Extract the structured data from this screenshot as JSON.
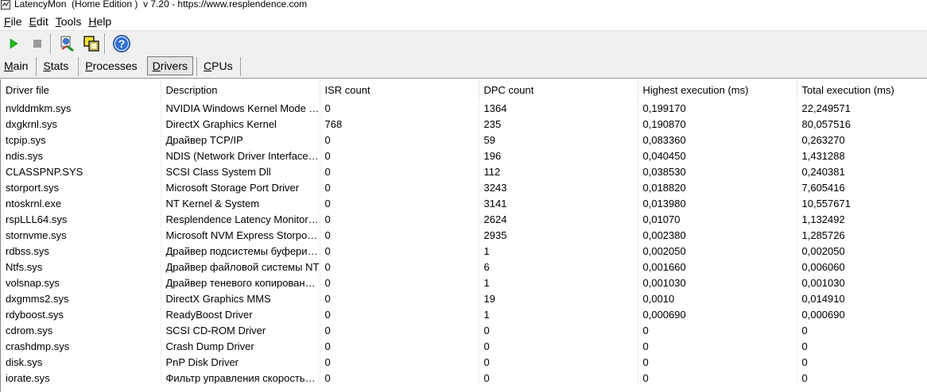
{
  "window": {
    "title": "LatencyMon  (Home Edition )  v 7.20 - https://www.resplendence.com"
  },
  "menu": [
    {
      "acc": "F",
      "rest": "ile"
    },
    {
      "acc": "E",
      "rest": "dit"
    },
    {
      "acc": "T",
      "rest": "ools"
    },
    {
      "acc": "H",
      "rest": "elp"
    }
  ],
  "toolbar": {
    "start_icon": "play-icon",
    "stop_icon": "stop-icon",
    "properties_icon": "driver-properties-icon",
    "report_icon": "copy-report-icon",
    "help_icon": "help-icon"
  },
  "tabs": [
    {
      "acc": "M",
      "rest": "ain"
    },
    {
      "acc": "S",
      "rest": "tats"
    },
    {
      "acc": "P",
      "rest": "rocesses"
    },
    {
      "acc": "D",
      "rest": "rivers"
    },
    {
      "acc": "C",
      "rest": "PUs"
    }
  ],
  "table": {
    "columns": [
      "Driver file",
      "Description",
      "ISR count",
      "DPC count",
      "Highest execution (ms)",
      "Total execution (ms)"
    ],
    "rows": [
      [
        "nvlddmkm.sys",
        "NVIDIA Windows Kernel Mode Driver",
        "0",
        "1364",
        "0,199170",
        "22,249571"
      ],
      [
        "dxgkrnl.sys",
        "DirectX Graphics Kernel",
        "768",
        "235",
        "0,190870",
        "80,057516"
      ],
      [
        "tcpip.sys",
        "Драйвер TCP/IP",
        "0",
        "59",
        "0,083360",
        "0,263270"
      ],
      [
        "ndis.sys",
        "NDIS (Network Driver Interface Specification)",
        "0",
        "196",
        "0,040450",
        "1,431288"
      ],
      [
        "CLASSPNP.SYS",
        "SCSI Class System Dll",
        "0",
        "112",
        "0,038530",
        "0,240381"
      ],
      [
        "storport.sys",
        "Microsoft Storage Port Driver",
        "0",
        "3243",
        "0,018820",
        "7,605416"
      ],
      [
        "ntoskrnl.exe",
        "NT Kernel & System",
        "0",
        "3141",
        "0,013980",
        "10,557671"
      ],
      [
        "rspLLL64.sys",
        "Resplendence Latency Monitoring",
        "0",
        "2624",
        "0,01070",
        "1,132492"
      ],
      [
        "stornvme.sys",
        "Microsoft NVM Express Storport Miniport",
        "0",
        "2935",
        "0,002380",
        "1,285726"
      ],
      [
        "rdbss.sys",
        "Драйвер подсистемы буферизации",
        "0",
        "1",
        "0,002050",
        "0,002050"
      ],
      [
        "Ntfs.sys",
        "Драйвер файловой системы NT",
        "0",
        "6",
        "0,001660",
        "0,006060"
      ],
      [
        "volsnap.sys",
        "Драйвер теневого копирования тома",
        "0",
        "1",
        "0,001030",
        "0,001030"
      ],
      [
        "dxgmms2.sys",
        "DirectX Graphics MMS",
        "0",
        "19",
        "0,0010",
        "0,014910"
      ],
      [
        "rdyboost.sys",
        "ReadyBoost Driver",
        "0",
        "1",
        "0,000690",
        "0,000690"
      ],
      [
        "cdrom.sys",
        "SCSI CD-ROM Driver",
        "0",
        "0",
        "0",
        "0"
      ],
      [
        "crashdmp.sys",
        "Crash Dump Driver",
        "0",
        "0",
        "0",
        "0"
      ],
      [
        "disk.sys",
        "PnP Disk Driver",
        "0",
        "0",
        "0",
        "0"
      ],
      [
        "iorate.sys",
        "Фильтр управления скоростью ввода-вывода",
        "0",
        "0",
        "0",
        "0"
      ]
    ]
  }
}
